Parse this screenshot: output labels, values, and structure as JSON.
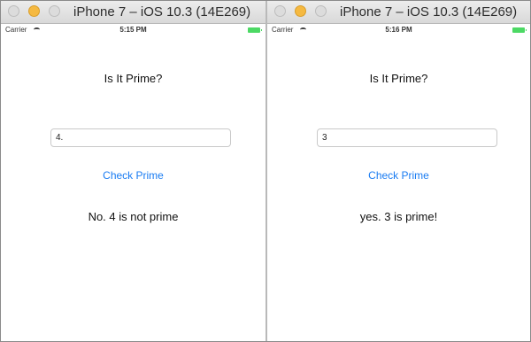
{
  "simulators": [
    {
      "window_title": "iPhone 7 – iOS 10.3 (14E269)",
      "status_bar": {
        "carrier": "Carrier",
        "time": "5:15 PM"
      },
      "app": {
        "title": "Is It Prime?",
        "number_field_value": "4.",
        "check_button_label": "Check Prime",
        "result_text": "No. 4 is not prime"
      }
    },
    {
      "window_title": "iPhone 7 – iOS 10.3 (14E269)",
      "status_bar": {
        "carrier": "Carrier",
        "time": "5:16 PM"
      },
      "app": {
        "title": "Is It Prime?",
        "number_field_value": "3",
        "check_button_label": "Check Prime",
        "result_text": "yes. 3 is prime!"
      }
    }
  ],
  "colors": {
    "link_blue": "#1a7cf2",
    "minimize_yellow": "#f5b941",
    "battery_green": "#4cd964"
  }
}
